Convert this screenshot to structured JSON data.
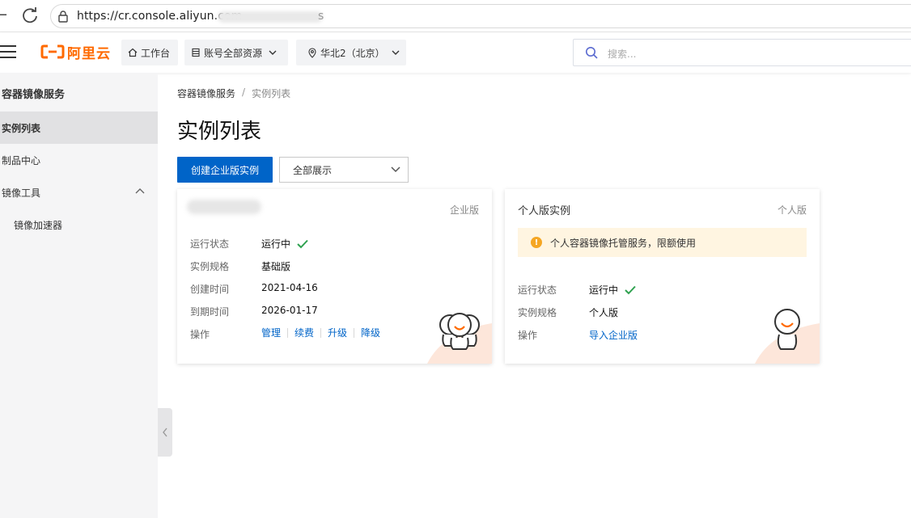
{
  "browser": {
    "url": "https://cr.console.aliyun.com",
    "url_tail": "s"
  },
  "topbar": {
    "logo_text": "阿里云",
    "workbench": "工作台",
    "account_resources": "账号全部资源",
    "region": "华北2（北京）",
    "search_placeholder": "搜索..."
  },
  "sidebar": {
    "title": "容器镜像服务",
    "items": [
      {
        "label": "实例列表",
        "active": true
      },
      {
        "label": "制品中心",
        "active": false
      },
      {
        "label": "镜像工具",
        "active": false,
        "expanded": true
      },
      {
        "label": "镜像加速器",
        "active": false,
        "sub": true
      }
    ]
  },
  "main": {
    "breadcrumb": [
      "容器镜像服务",
      "实例列表"
    ],
    "breadcrumb_sep": "/",
    "title": "实例列表",
    "create_button": "创建企业版实例",
    "filter_select": "全部展示"
  },
  "cards": [
    {
      "tag": "企业版",
      "rows": [
        {
          "label": "运行状态",
          "value": "运行中",
          "ok": true
        },
        {
          "label": "实例规格",
          "value": "基础版"
        },
        {
          "label": "创建时间",
          "value": "2021-04-16"
        },
        {
          "label": "到期时间",
          "value": "2026-01-17"
        }
      ],
      "ops_label": "操作",
      "ops": [
        "管理",
        "续费",
        "升级",
        "降级"
      ]
    },
    {
      "title": "个人版实例",
      "tag": "个人版",
      "notice": "个人容器镜像托管服务，限额使用",
      "rows": [
        {
          "label": "运行状态",
          "value": "运行中",
          "ok": true
        },
        {
          "label": "实例规格",
          "value": "个人版"
        }
      ],
      "ops_label": "操作",
      "op_link": "导入企业版"
    }
  ],
  "colors": {
    "brand": "#ff6a00",
    "primary": "#0064c8",
    "success": "#2ea14f",
    "warning": "#f5a623"
  }
}
